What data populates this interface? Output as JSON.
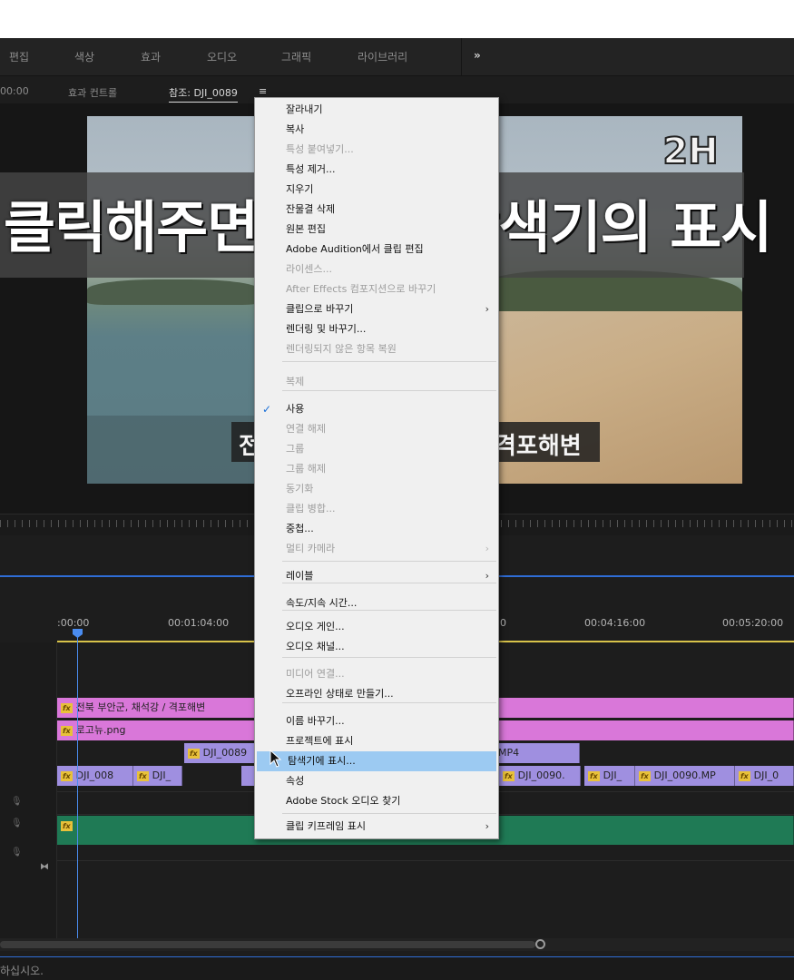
{
  "workspace_tabs": [
    "편집",
    "색상",
    "효과",
    "오디오",
    "그래픽",
    "라이브러리",
    "»"
  ],
  "panel_tabs": {
    "timecode": "00:00",
    "effect_controls": "효과 컨트롤",
    "reference": "참조: DJI_0089",
    "reference_menu": "≡"
  },
  "video": {
    "logo_text": "2H",
    "subtitle_left": "전",
    "subtitle_right": "격포해변"
  },
  "overlay_caption": "클릭해주면 여기서 탐색기의 표시",
  "timeline": {
    "times": [
      ":00:00",
      "00:01:04:00",
      "0",
      "00:04:16:00",
      "00:05:20:00"
    ],
    "clips": {
      "v3_title": "전북 부안군, 채석강 / 격포해변",
      "v2_logo": "로고뉴.png",
      "v1_a": "DJI_0089",
      "v1_b": "MP4",
      "v0_a": "DJI_008",
      "v0_b": "DJI_",
      "v0_c": "DJI_0090.",
      "v0_d": "DJI_",
      "v0_e": "DJI_0090.MP",
      "v0_f": "DJI_0"
    },
    "track_icon": "⧓"
  },
  "status_text": "하십시오.",
  "context_menu": {
    "items": [
      {
        "label": "잘라내기",
        "disabled": false
      },
      {
        "label": "복사",
        "disabled": false
      },
      {
        "label": "특성 붙여넣기...",
        "disabled": true
      },
      {
        "label": "특성 제거...",
        "disabled": false
      },
      {
        "label": "지우기",
        "disabled": false
      },
      {
        "label": "잔물결 삭제",
        "disabled": false
      },
      {
        "label": "원본 편집",
        "disabled": false
      },
      {
        "label": "Adobe Audition에서 클립 편집",
        "disabled": false
      },
      {
        "label": "라이센스...",
        "disabled": true
      },
      {
        "label": "After Effects 컴포지션으로 바꾸기",
        "disabled": true
      },
      {
        "label": "클립으로 바꾸기",
        "disabled": false
      },
      {
        "label": "렌더링 및 바꾸기...",
        "disabled": false
      },
      {
        "label": "렌더링되지 않은 항목 복원",
        "disabled": true
      },
      {
        "label": "복제",
        "disabled": true
      },
      {
        "label": "사용",
        "disabled": false
      },
      {
        "label": "연결 해제",
        "disabled": true
      },
      {
        "label": "그룹",
        "disabled": true
      },
      {
        "label": "그룹 해제",
        "disabled": true
      },
      {
        "label": "동기화",
        "disabled": true
      },
      {
        "label": "클립 병합...",
        "disabled": true
      },
      {
        "label": "중첩...",
        "disabled": false
      },
      {
        "label": "멀티 카메라",
        "disabled": true
      },
      {
        "label": "레이블",
        "disabled": false
      },
      {
        "label": "속도/지속 시간...",
        "disabled": false
      },
      {
        "label": "오디오 게인...",
        "disabled": false
      },
      {
        "label": "오디오 채널...",
        "disabled": false
      },
      {
        "label": "미디어 연결...",
        "disabled": true
      },
      {
        "label": "오프라인 상태로 만들기...",
        "disabled": false
      },
      {
        "label": "이름 바꾸기...",
        "disabled": false
      },
      {
        "label": "프로젝트에 표시",
        "disabled": false
      },
      {
        "label": "탐색기에 표시...",
        "disabled": false,
        "highlighted": true
      },
      {
        "label": "속성",
        "disabled": false
      },
      {
        "label": "Adobe Stock 오디오 찾기",
        "disabled": false
      },
      {
        "label": "클립 키프레임 표시",
        "disabled": false
      }
    ],
    "checked_item": "사용",
    "check_glyph": "✓",
    "submenu_glyph": "›"
  },
  "colors": {
    "highlight": "#9ccaf2",
    "clip_pink": "#d977d9",
    "clip_violet": "#9f8fe0",
    "audio_green": "#1f7a55",
    "playhead": "#4a8cf0"
  }
}
